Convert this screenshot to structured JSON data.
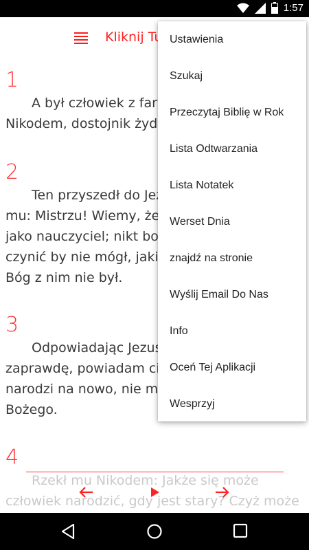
{
  "status_bar": {
    "time": "1:57",
    "icons": [
      "wifi-icon",
      "cellular-signal-icon",
      "battery-icon"
    ]
  },
  "top_bar": {
    "title": "Kliknij Tu",
    "menu_icon": "chapter-list-icon"
  },
  "verses": [
    {
      "number": "1",
      "text": "A był człowiek z fary\nNikodem, dostojnik żydo"
    },
    {
      "number": "2",
      "text": "Ten przyszedł do Jez\nmu: Mistrzu! Wiemy, że\njako nauczyciel; nikt bow\nczynić by nie mógł, jakie\nBóg z nim nie był."
    },
    {
      "number": "3",
      "text": "Odpowiadając Jezus\nzaprawdę, powiadam ci,\nnarodzi na nowo, nie mo\nBożego."
    },
    {
      "number": "4",
      "text": "Rzekł mu Nikodem: Jakże się może\nczłowiek narodzić, gdy jest stary? Czyż może"
    }
  ],
  "menu": {
    "items": [
      "Ustawienia",
      "Szukaj",
      "Przeczytaj Biblię w Rok",
      "Lista Odtwarzania",
      "Lista Notatek",
      "Werset Dnia",
      "znajdź na stronie",
      "Wyślij Email Do Nas",
      "Info",
      "Oceń Tej Aplikacji",
      "Wesprzyj"
    ]
  },
  "colors": {
    "accent": "#ff2222",
    "text": "#3a3a3a",
    "status_bar": "#000000"
  }
}
